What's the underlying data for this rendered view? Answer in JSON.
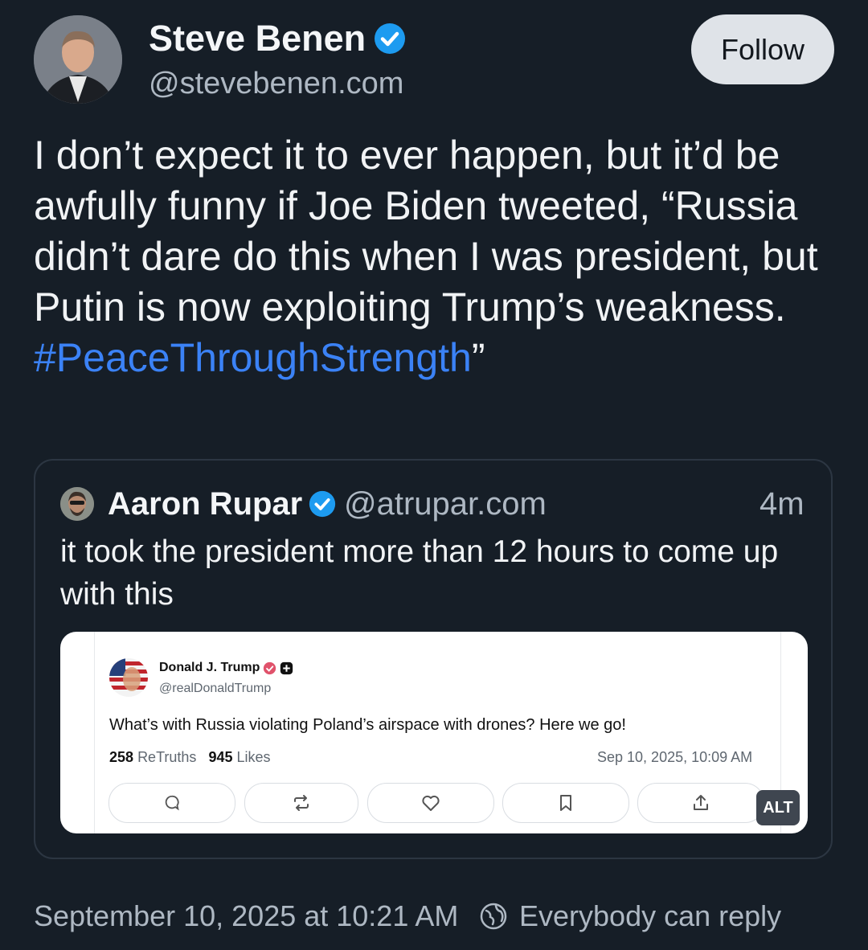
{
  "author": {
    "display_name": "Steve Benen",
    "handle": "@stevebenen.com",
    "follow_label": "Follow"
  },
  "post": {
    "text": "I don’t expect it to ever happen, but it’d be awfully funny if Joe Biden tweeted, “Russia didn’t dare do this when I was president, but Putin is now exploiting Trump’s weakness. ",
    "hashtag": "#PeaceThroughStrength",
    "text_end": "”"
  },
  "quote": {
    "display_name": "Aaron Rupar",
    "handle": "@atrupar.com",
    "time": "4m",
    "text": "it took the president more than 12 hours to come up with this",
    "image": {
      "author_name": "Donald J. Trump",
      "author_handle": "@realDonaldTrump",
      "text": "What’s with Russia violating Poland’s airspace with drones? Here we go!",
      "retruths_count": "258",
      "retruths_label": "ReTruths",
      "likes_count": "945",
      "likes_label": "Likes",
      "date": "Sep 10, 2025, 10:09 AM",
      "alt_badge": "ALT"
    }
  },
  "footer": {
    "timestamp": "September 10, 2025 at 10:21 AM",
    "reply_setting": "Everybody can reply"
  },
  "colors": {
    "background": "#161e27",
    "link": "#3b82f6",
    "verified": "#1d9bf0",
    "muted": "#aeb8c3"
  }
}
